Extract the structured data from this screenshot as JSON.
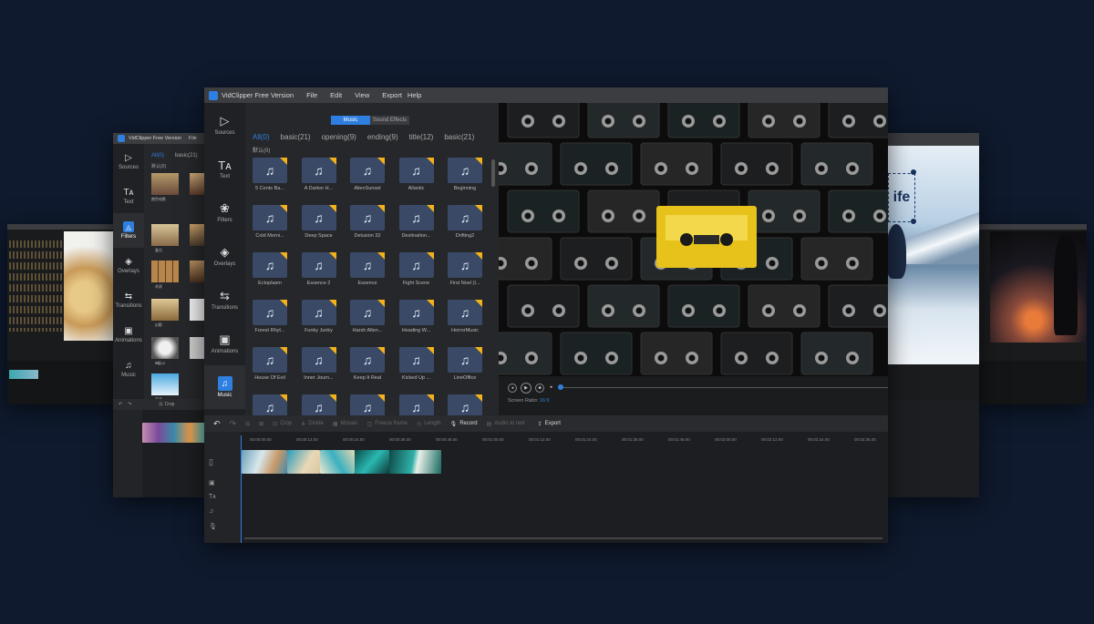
{
  "app": {
    "title": "VidClipper Free Version",
    "menu": [
      "File",
      "Edit",
      "View",
      "Export",
      "Help"
    ]
  },
  "sidebar": [
    {
      "label": "Sources",
      "icon": "play-folder-icon"
    },
    {
      "label": "Text",
      "icon": "text-icon"
    },
    {
      "label": "Filters",
      "icon": "filters-icon"
    },
    {
      "label": "Overlays",
      "icon": "overlays-icon"
    },
    {
      "label": "Transitions",
      "icon": "transitions-icon"
    },
    {
      "label": "Animations",
      "icon": "animations-icon"
    },
    {
      "label": "Music",
      "icon": "music-icon",
      "active": true
    }
  ],
  "library": {
    "tabs": [
      "Music",
      "Sound Effects"
    ],
    "categories": [
      "All(0)",
      "basic(21)",
      "opening(9)",
      "ending(9)",
      "title(12)",
      "basic(21)"
    ],
    "subcategory": "默认(0)",
    "items": [
      "5 Cents Ba...",
      "A Darker H...",
      "AlienSunset",
      "Allantic",
      "Beginning",
      "Cold Morni...",
      "Deep Space",
      "Delusion 32",
      "Destination...",
      "Drifting2",
      "Ectoplasm",
      "Essence 2",
      "Essence",
      "Fight Scene",
      "First Noel (I...",
      "Forest Rhyt...",
      "Funky Junky",
      "Harsh Allen...",
      "Heading W...",
      "HorrorMusic",
      "House Of Evil",
      "Inner Journ...",
      "Keep It Real",
      "Kicked Up ...",
      "LineOffice",
      "",
      "",
      "",
      "",
      ""
    ]
  },
  "preview": {
    "screen_ratio_label": "Screen Ratio:",
    "screen_ratio_value": "16:9"
  },
  "toolbar": {
    "items": [
      "Crop",
      "Divide",
      "Mosaic",
      "Freeze frame",
      "Length",
      "Record",
      "Audio to text",
      "Export"
    ]
  },
  "timeline": {
    "ruler": [
      "00:00:00.00",
      "00:00:12.00",
      "00:00:24.00",
      "00:00:36.00",
      "00:00:48.00",
      "00:01:00.00",
      "00:01:12.00",
      "00:01:24.00",
      "00:01:36.00",
      "00:01:48.00",
      "00:02:00.00",
      "00:02:12.00",
      "00:02:24.00",
      "00:02:36.00"
    ]
  },
  "back_window": {
    "title": "VidClipper Free Version",
    "menu": [
      "File"
    ],
    "categories": [
      "All(0)",
      "basic(21)"
    ],
    "subcategory": "默认(0)",
    "filter_names": [
      "颜色电影",
      "复古",
      "木质",
      "幻影",
      "冰冷",
      "Ⅲ级12",
      "高清"
    ],
    "toolbar_crop": "Crop"
  },
  "right_window": {
    "overlay_text": "ife"
  },
  "colors": {
    "accent": "#2f7fe0",
    "badge": "#f3b21a",
    "background": "#0f1a2e"
  }
}
